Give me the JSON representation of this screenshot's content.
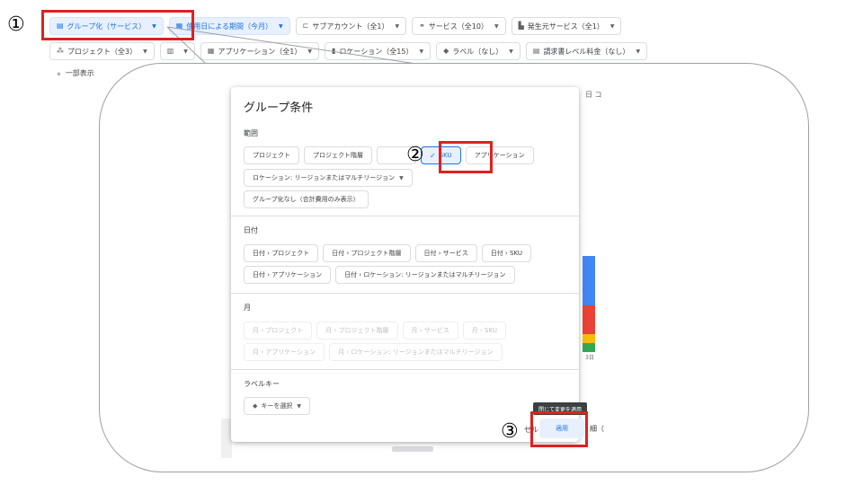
{
  "toolbar_row1": [
    {
      "icon": "list-icon",
      "glyph": "▤",
      "label": "グループ化（サービス）",
      "active": true
    },
    {
      "icon": "calendar-icon",
      "glyph": "▦",
      "label": "使用日による期間（今月）",
      "active": true
    },
    {
      "icon": "subaccount-icon",
      "glyph": "⊏",
      "label": "サブアカウント（全1）",
      "active": false
    },
    {
      "icon": "services-icon",
      "glyph": "⚭",
      "label": "サービス（全10）",
      "active": false
    },
    {
      "icon": "origin-service-icon",
      "glyph": "▙",
      "label": "発生元サービス（全1）",
      "active": false
    }
  ],
  "toolbar_row2": [
    {
      "icon": "project-icon",
      "glyph": "⁂",
      "label": "プロジェクト（全3）",
      "active": false
    },
    {
      "icon": "chart-icon",
      "glyph": "▥",
      "label": "",
      "active": false
    },
    {
      "icon": "app-grid-icon",
      "glyph": "▦",
      "label": "アプリケーション（全1）",
      "active": false
    },
    {
      "icon": "location-icon",
      "glyph": "▮",
      "label": "ロケーション（全15）",
      "active": false
    },
    {
      "icon": "label-icon",
      "glyph": "◆",
      "label": "ラベル（なし）",
      "active": false
    },
    {
      "icon": "invoice-icon",
      "glyph": "▤",
      "label": "請求書レベル料金（なし）",
      "active": false
    }
  ],
  "collapse_label": "一部表示",
  "panel": {
    "title": "グループ条件",
    "sections": [
      {
        "title": "範囲",
        "rows": [
          [
            {
              "label": "プロジェクト"
            },
            {
              "label": "プロジェクト階層"
            },
            {
              "label": ""
            },
            {
              "label": "SKU",
              "selected": true
            },
            {
              "label": "アプリケーション"
            }
          ],
          [
            {
              "label": "ロケーション: リージョンまたはマルチリージョン",
              "caret": true
            }
          ],
          [
            {
              "label": "グループ化なし（合計費用のみ表示）"
            }
          ]
        ]
      },
      {
        "title": "日付",
        "rows": [
          [
            {
              "label": "日付 › プロジェクト"
            },
            {
              "label": "日付 › プロジェクト階層"
            },
            {
              "label": "日付 › サービス"
            },
            {
              "label": "日付 › SKU"
            }
          ],
          [
            {
              "label": "日付 › アプリケーション"
            },
            {
              "label": "日付 › ロケーション: リージョンまたはマルチリージョン"
            }
          ]
        ]
      },
      {
        "title": "月",
        "rows": [
          [
            {
              "label": "月 › プロジェクト",
              "disabled": true
            },
            {
              "label": "月 › プロジェクト階層",
              "disabled": true
            },
            {
              "label": "月 › サービス",
              "disabled": true
            },
            {
              "label": "月 › SKU",
              "disabled": true
            }
          ],
          [
            {
              "label": "月 › アプリケーション",
              "disabled": true
            },
            {
              "label": "月 › ロケーション: リージョンまたはマルチリージョン",
              "disabled": true
            }
          ]
        ]
      },
      {
        "title": "ラベルキー",
        "rows": [
          [
            {
              "label": "キーを選択",
              "icon": "label-icon",
              "caret": true
            }
          ]
        ]
      }
    ]
  },
  "apply_button": "適用",
  "apply_tooltip": "閉じて変更を適用",
  "background_fragments": {
    "col_label": "日 コ",
    "axis_label": "3日",
    "left_fragment": "セル",
    "right_fragment": "細（"
  },
  "bar_segments_colors": [
    "#4285f4",
    "#ea4335",
    "#fbbc04",
    "#34a853"
  ],
  "annotations": [
    "①",
    "②",
    "③"
  ],
  "accent_color": "#1a73e8",
  "highlight_color": "#e02020"
}
